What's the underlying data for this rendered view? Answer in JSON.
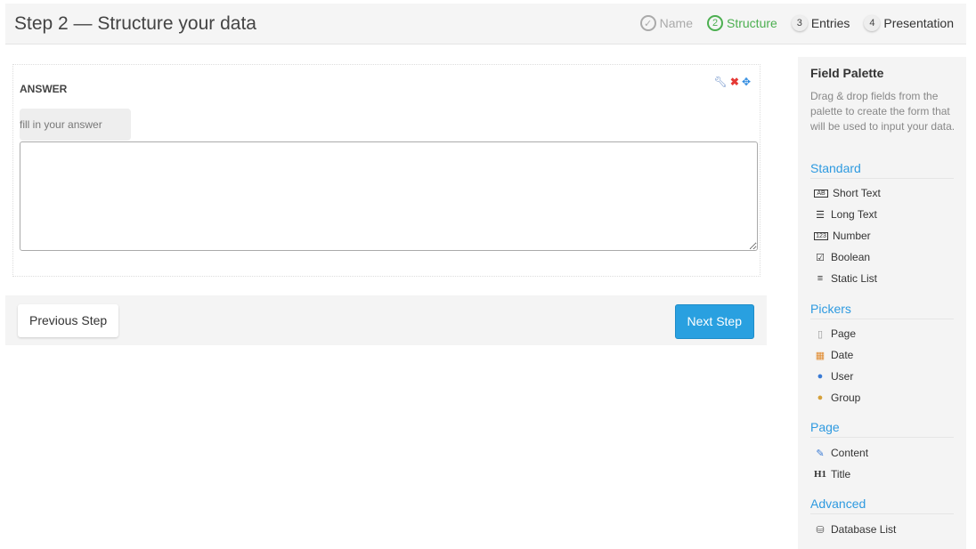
{
  "header": {
    "title": "Step 2 — Structure your data",
    "steps": [
      {
        "n": "✓",
        "label": "Name"
      },
      {
        "n": "2",
        "label": "Structure"
      },
      {
        "n": "3",
        "label": "Entries"
      },
      {
        "n": "4",
        "label": "Presentation"
      }
    ]
  },
  "field": {
    "label": "ANSWER",
    "placeholder": "fill in your answer"
  },
  "footer": {
    "prev": "Previous Step",
    "next": "Next Step"
  },
  "palette": {
    "title": "Field Palette",
    "desc": "Drag & drop fields from the palette to create the form that will be used to input your data.",
    "sections": [
      {
        "label": "Standard"
      },
      {
        "label": "Pickers"
      },
      {
        "label": "Page"
      },
      {
        "label": "Advanced"
      }
    ],
    "items": [
      {
        "icon": "short-text-icon",
        "label": "Short Text"
      },
      {
        "icon": "long-text-icon",
        "label": "Long Text"
      },
      {
        "icon": "number-icon",
        "label": "Number"
      },
      {
        "icon": "checkbox-icon",
        "label": "Boolean"
      },
      {
        "icon": "list-icon",
        "label": "Static List"
      },
      {
        "icon": "page-icon",
        "label": "Page"
      },
      {
        "icon": "calendar-icon",
        "label": "Date"
      },
      {
        "icon": "user-icon",
        "label": "User"
      },
      {
        "icon": "group-icon",
        "label": "Group"
      },
      {
        "icon": "content-icon",
        "label": "Content"
      },
      {
        "icon": "heading-icon",
        "label": "Title"
      },
      {
        "icon": "database-icon",
        "label": "Database List"
      }
    ]
  }
}
